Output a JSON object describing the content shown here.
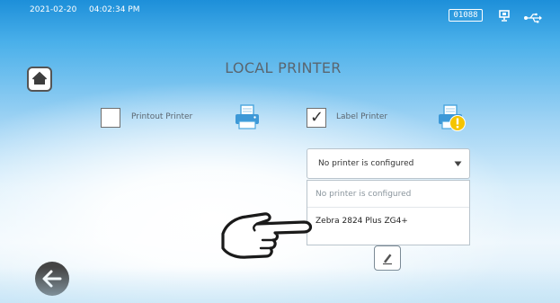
{
  "status_bar": {
    "date": "2021-02-20",
    "time": "04:02:34 PM",
    "counter": "01088",
    "icons": [
      "monitor-connection-icon",
      "usb-icon"
    ]
  },
  "header": {
    "title": "LOCAL PRINTER",
    "home_icon": "home-icon"
  },
  "printers": {
    "printout": {
      "label": "Printout Printer",
      "checked": false,
      "icon": "printer-icon"
    },
    "label": {
      "label": "Label Printer",
      "checked": true,
      "checkmark": "✓",
      "icon": "printer-warning-icon"
    }
  },
  "select": {
    "value": "No printer is configured",
    "options": [
      "No printer is configured",
      "Zebra 2824 Plus ZG4+"
    ],
    "selected_index": 0,
    "hovered_index": 1,
    "arrow_icon": "chevron-down-icon"
  },
  "footer": {
    "edit_icon": "pencil-icon",
    "back_icon": "back-arrow-icon"
  },
  "overlay": {
    "hand_icon": "pointing-hand-icon"
  },
  "colors": {
    "accent_blue": "#1d8fd9",
    "warning_yellow": "#f5c400",
    "disabled_text": "#8a959d",
    "dark_button": "#444444"
  }
}
